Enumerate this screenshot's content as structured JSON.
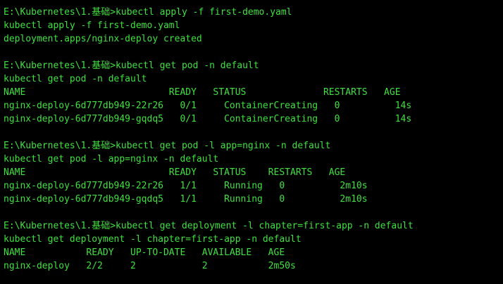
{
  "terminal": {
    "colors": {
      "background": "#000000",
      "text": "#3fe03f"
    },
    "lines": [
      "E:\\Kubernetes\\1.基础>kubectl apply -f first-demo.yaml",
      "kubectl apply -f first-demo.yaml",
      "deployment.apps/nginx-deploy created",
      "",
      "E:\\Kubernetes\\1.基础>kubectl get pod -n default",
      "kubectl get pod -n default",
      "NAME                          READY   STATUS              RESTARTS   AGE",
      "nginx-deploy-6d777db949-22r26   0/1     ContainerCreating   0          14s",
      "nginx-deploy-6d777db949-gqdq5   0/1     ContainerCreating   0          14s",
      "",
      "E:\\Kubernetes\\1.基础>kubectl get pod -l app=nginx -n default",
      "kubectl get pod -l app=nginx -n default",
      "NAME                          READY   STATUS    RESTARTS   AGE",
      "nginx-deploy-6d777db949-22r26   1/1     Running   0          2m10s",
      "nginx-deploy-6d777db949-gqdq5   1/1     Running   0          2m10s",
      "",
      "E:\\Kubernetes\\1.基础>kubectl get deployment -l chapter=first-app -n default",
      "kubectl get deployment -l chapter=first-app -n default",
      "NAME           READY   UP-TO-DATE   AVAILABLE   AGE",
      "nginx-deploy   2/2     2            2           2m50s"
    ]
  }
}
